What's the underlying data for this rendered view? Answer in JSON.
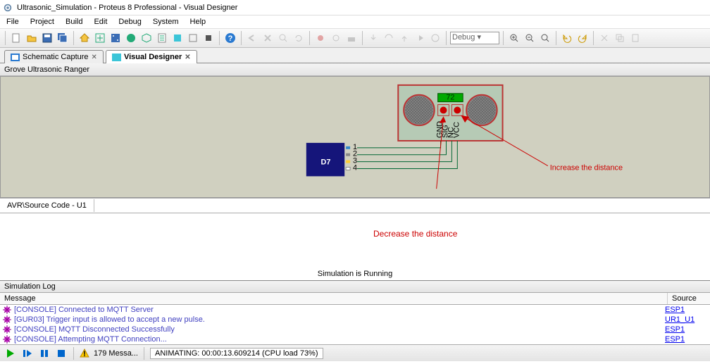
{
  "title": "Ultrasonic_Simulation - Proteus 8 Professional - Visual Designer",
  "menu": {
    "items": [
      "File",
      "Project",
      "Build",
      "Edit",
      "Debug",
      "System",
      "Help"
    ]
  },
  "toolbar_debug_combo": "Debug",
  "tabs": [
    {
      "label": "Schematic Capture",
      "active": false
    },
    {
      "label": "Visual Designer",
      "active": true
    }
  ],
  "panel_header": "Grove Ultrasonic Ranger",
  "sensor": {
    "display_value": "72",
    "pins": [
      "GND",
      "SIG",
      "NC",
      "VCC"
    ],
    "port_label": "D7",
    "port_pins": [
      "1",
      "2",
      "3",
      "4"
    ]
  },
  "annotations": {
    "increase": "Increase the distance",
    "decrease": "Decrease the distance"
  },
  "source_tab": "AVR\\Source Code - U1",
  "sim_running": "Simulation is Running",
  "log": {
    "header": "Simulation Log",
    "col_msg": "Message",
    "col_src": "Source",
    "rows": [
      {
        "msg": "[CONSOLE] Connected to MQTT Server",
        "src": "ESP1"
      },
      {
        "msg": "[GUR03] Trigger input is allowed to accept a new pulse.",
        "src": "UR1_U1"
      },
      {
        "msg": "[CONSOLE] MQTT Disconnected Successfully",
        "src": "ESP1"
      },
      {
        "msg": "[CONSOLE] Attempting MQTT Connection...",
        "src": "ESP1"
      }
    ]
  },
  "status": {
    "msg_count": "179 Messa...",
    "animating": "ANIMATING: 00:00:13.609214 (CPU load 73%)"
  }
}
